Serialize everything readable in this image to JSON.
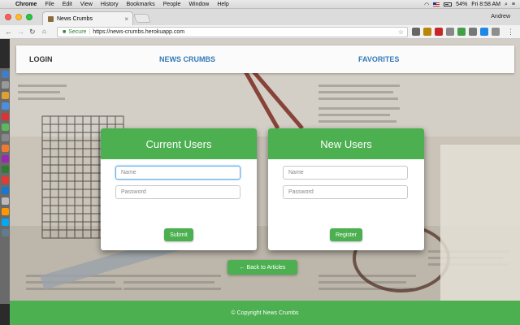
{
  "menubar": {
    "app": "Chrome",
    "items": [
      "File",
      "Edit",
      "View",
      "History",
      "Bookmarks",
      "People",
      "Window",
      "Help"
    ],
    "battery": "54%",
    "clock": "Fri 8:58 AM"
  },
  "browser": {
    "tab_title": "News Crumbs",
    "profile": "Andrew",
    "secure_label": "Secure",
    "url": "https://news-crumbs.herokuapp.com"
  },
  "header": {
    "login": "LOGIN",
    "brand": "NEWS CRUMBS",
    "favorites": "FAVORITES"
  },
  "current_users": {
    "title": "Current Users",
    "name_placeholder": "Name",
    "password_placeholder": "Password",
    "submit": "Submit"
  },
  "new_users": {
    "title": "New Users",
    "name_placeholder": "Name",
    "password_placeholder": "Password",
    "register": "Register"
  },
  "back_button": "← Back to Articles",
  "footer": "© Copyright News Crumbs",
  "colors": {
    "accent": "#4caf50",
    "link": "#337ab7"
  }
}
